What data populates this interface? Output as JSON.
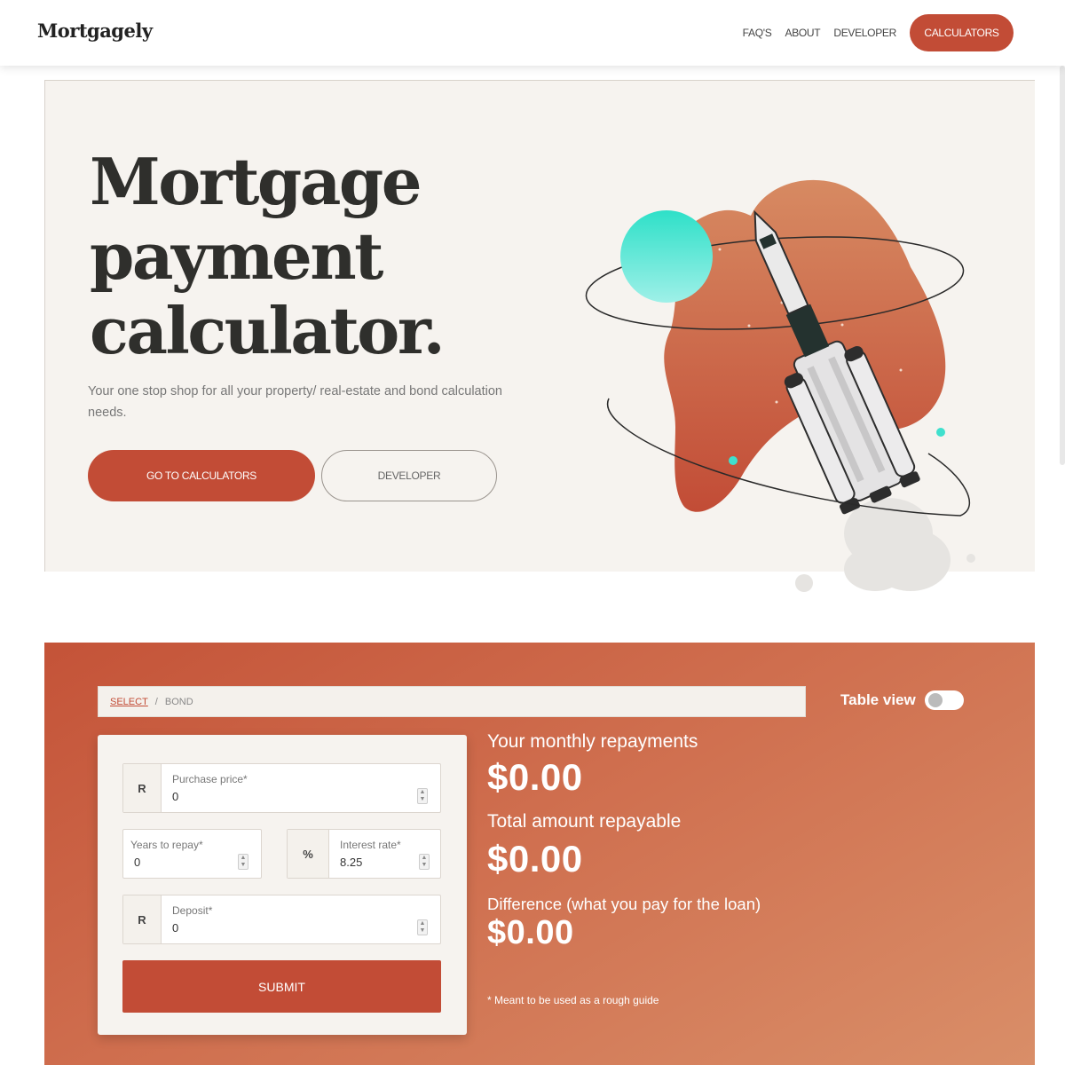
{
  "header": {
    "logo": "Mortgagely",
    "nav": [
      "FAQ'S",
      "ABOUT",
      "DEVELOPER"
    ],
    "cta": "CALCULATORS"
  },
  "hero": {
    "title_lines": [
      "Mortgage",
      "payment",
      "calculator."
    ],
    "subtitle": "Your one stop shop for all your property/ real-estate and bond calculation needs.",
    "primary_button": "GO TO CALCULATORS",
    "secondary_button": "DEVELOPER",
    "illustration": "rocket-launch-illustration"
  },
  "calculator": {
    "breadcrumb": {
      "link": "SELECT",
      "separator": "/",
      "current": "BOND"
    },
    "table_view": {
      "label": "Table view",
      "on": false
    },
    "fields": {
      "purchase_price": {
        "addon": "R",
        "label": "Purchase price*",
        "value": "0"
      },
      "years": {
        "label": "Years to repay*",
        "value": "0"
      },
      "interest": {
        "addon": "%",
        "label": "Interest rate*",
        "value": "8.25"
      },
      "deposit": {
        "addon": "R",
        "label": "Deposit*",
        "value": "0"
      }
    },
    "submit": "SUBMIT",
    "results": {
      "monthly_label": "Your monthly repayments",
      "monthly_value": "$0.00",
      "total_label": "Total amount repayable",
      "total_value": "$0.00",
      "diff_label": "Difference (what you pay for the loan)",
      "diff_value": "$0.00"
    },
    "note": "* Meant to be used as a rough guide"
  },
  "colors": {
    "accent": "#c24c36",
    "hero_bg": "#f6f3ef",
    "teal": "#3fe0cd"
  }
}
